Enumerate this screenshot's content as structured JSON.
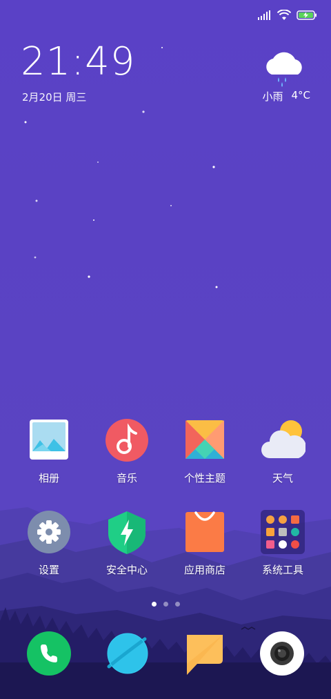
{
  "clock": {
    "time": "21:49",
    "date": "2月20日 周三"
  },
  "weather": {
    "condition": "小雨",
    "temperature": "4°C"
  },
  "apps_row1": [
    {
      "label": "相册",
      "icon": "gallery-icon"
    },
    {
      "label": "音乐",
      "icon": "music-icon"
    },
    {
      "label": "个性主题",
      "icon": "themes-icon"
    },
    {
      "label": "天气",
      "icon": "weather-icon"
    }
  ],
  "apps_row2": [
    {
      "label": "设置",
      "icon": "gear-icon"
    },
    {
      "label": "安全中心",
      "icon": "shield-icon"
    },
    {
      "label": "应用商店",
      "icon": "store-bag-icon"
    },
    {
      "label": "系统工具",
      "icon": "folder-icon"
    }
  ],
  "dock": [
    {
      "icon": "phone-icon"
    },
    {
      "icon": "browser-planet-icon"
    },
    {
      "icon": "message-icon"
    },
    {
      "icon": "camera-icon"
    }
  ],
  "page_indicator": {
    "count": 3,
    "active": 1
  },
  "colors": {
    "wallpaper": "#5a43c4",
    "mountain_light": "#4b3fa8",
    "mountain_dark": "#201a5c"
  }
}
